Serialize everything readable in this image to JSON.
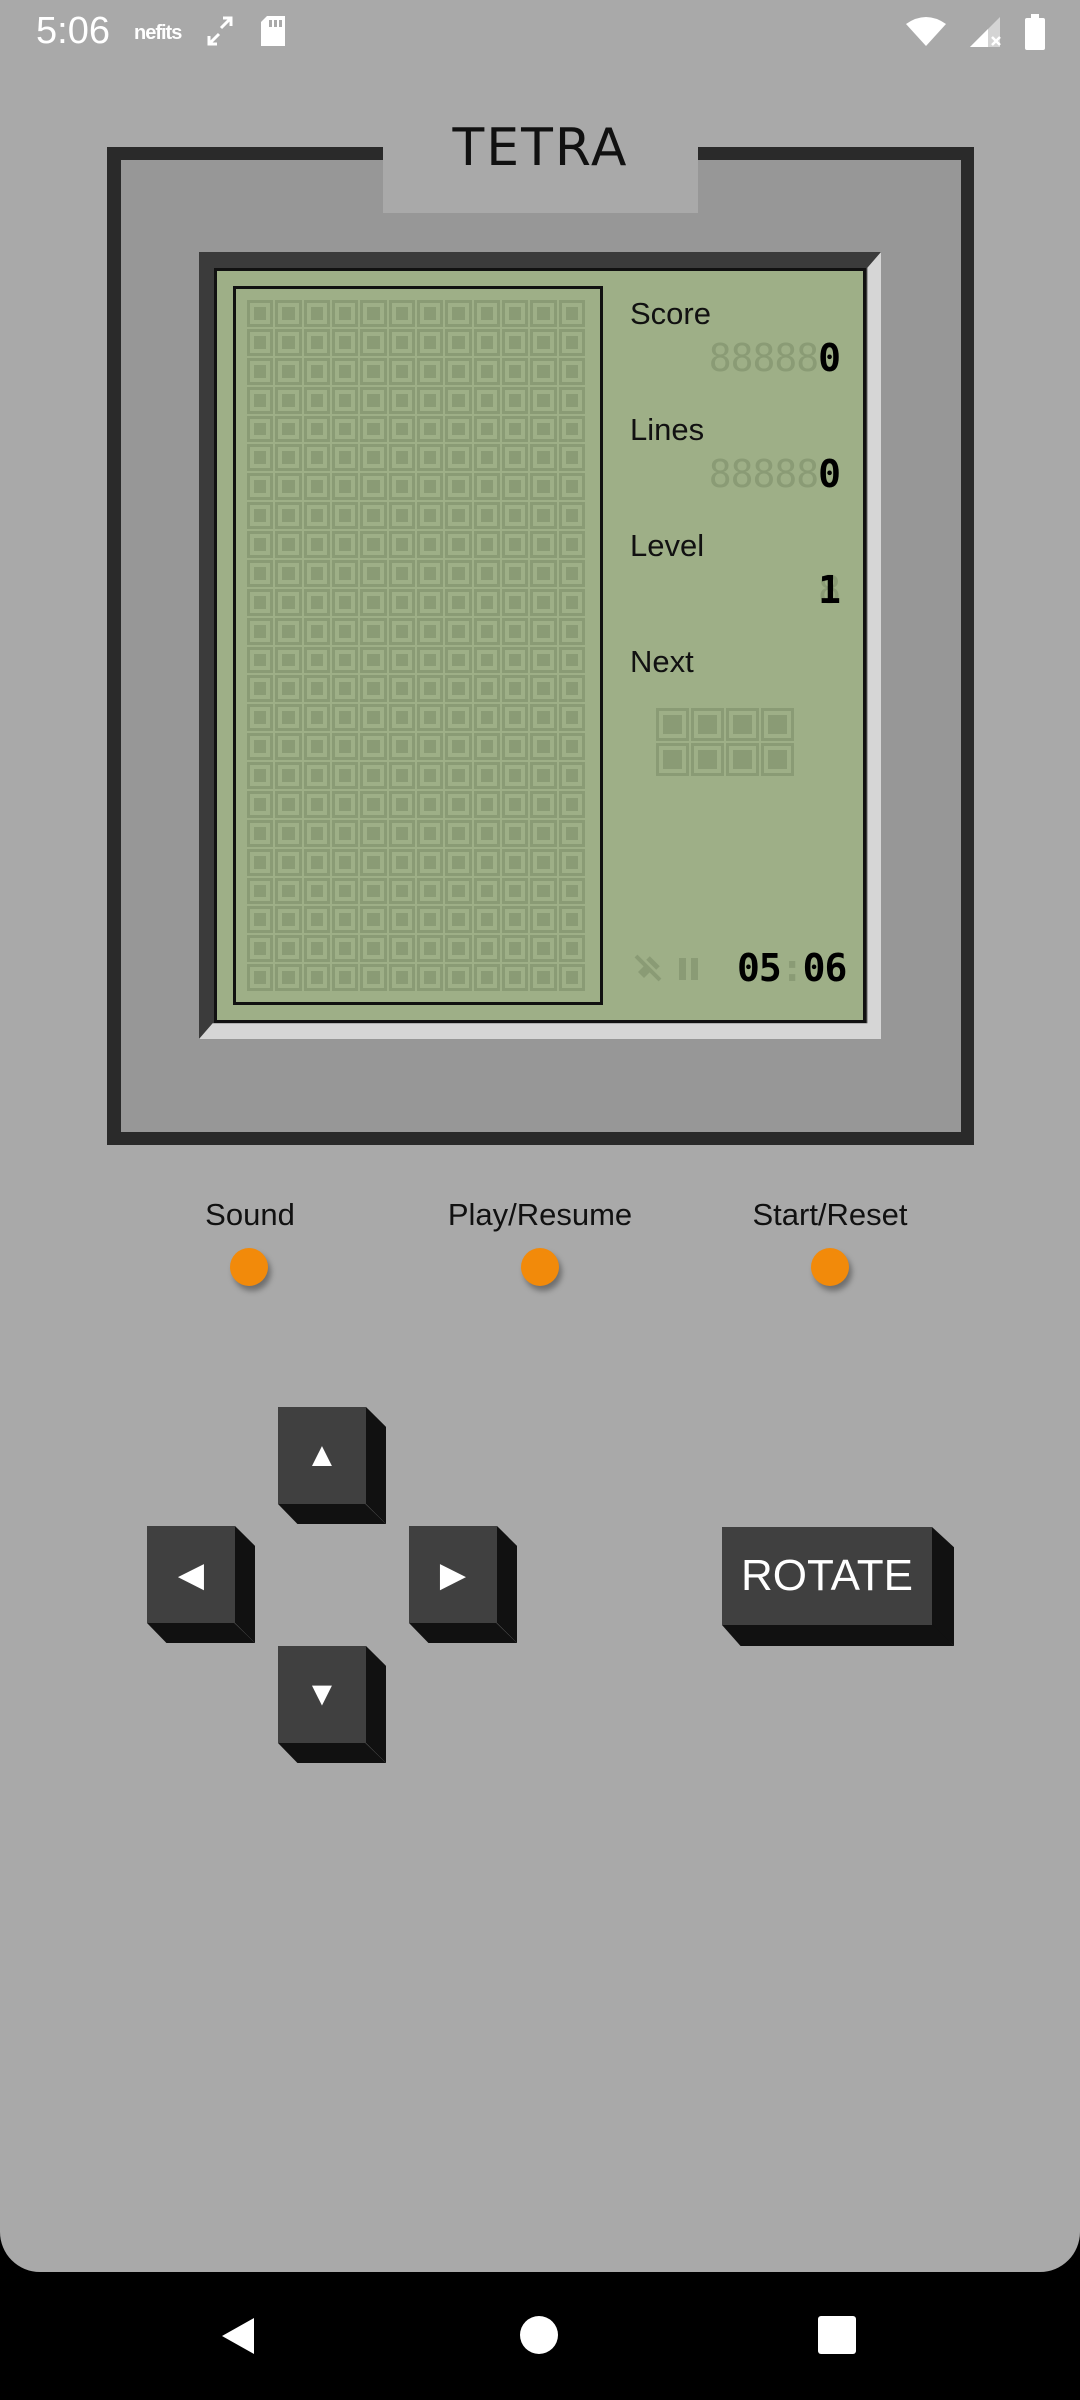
{
  "status_bar": {
    "time": "5:06",
    "left_icons": [
      "netfits-icon",
      "sync-icon",
      "sd-card-icon"
    ],
    "netfits_text": "nefits",
    "right_icons": [
      "wifi-icon",
      "signal-icon",
      "battery-icon"
    ]
  },
  "title": "TETRA",
  "lcd": {
    "score_label": "Score",
    "score_ghost": "88888",
    "score_value": "0",
    "lines_label": "Lines",
    "lines_ghost": "88888",
    "lines_value": "0",
    "level_label": "Level",
    "level_ghost": "8",
    "level_value": "1",
    "next_label": "Next",
    "clock_hours": "05",
    "clock_colon": ":",
    "clock_minutes": "06",
    "board_columns": 12,
    "board_rows": 24
  },
  "controls": {
    "sound_label": "Sound",
    "play_label": "Play/Resume",
    "start_label": "Start/Reset",
    "dot_color": "#f28a0a"
  },
  "keys": {
    "up": "▲",
    "left": "◀",
    "right": "▶",
    "down": "▼",
    "rotate": "ROTATE"
  },
  "nav_bar": [
    "back-icon",
    "home-icon",
    "recents-icon"
  ]
}
